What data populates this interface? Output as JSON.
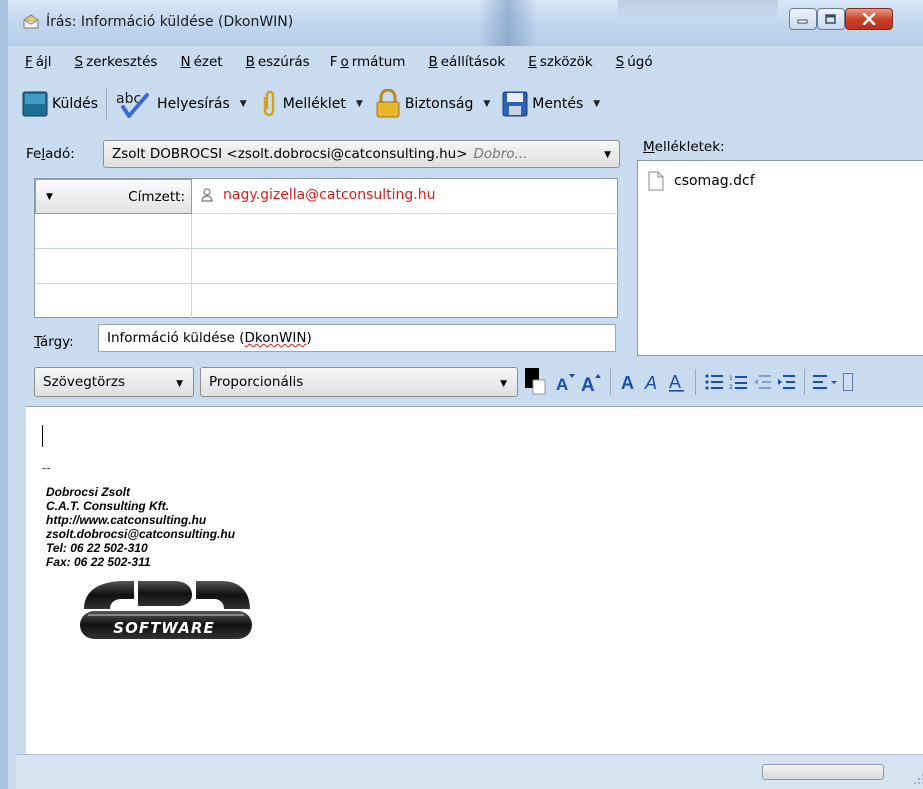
{
  "window": {
    "title": "Írás: Információ küldése (DkonWIN)"
  },
  "menu": [
    {
      "pre": "",
      "u": "F",
      "post": "ájl"
    },
    {
      "pre": "",
      "u": "S",
      "post": "zerkesztés"
    },
    {
      "pre": "",
      "u": "N",
      "post": "ézet"
    },
    {
      "pre": "",
      "u": "B",
      "post": "eszúrás"
    },
    {
      "pre": "F",
      "u": "o",
      "post": "rmátum"
    },
    {
      "pre": "",
      "u": "B",
      "post": "eállítások"
    },
    {
      "pre": "",
      "u": "E",
      "post": "szközök"
    },
    {
      "pre": "",
      "u": "S",
      "post": "úgó"
    }
  ],
  "toolbar": {
    "send": "Küldés",
    "spell": "Helyesírás",
    "spell_icon_text": "abc",
    "attach": "Melléklet",
    "security": "Biztonság",
    "save": "Mentés"
  },
  "from": {
    "label_pre": "Fe",
    "label_u": "l",
    "label_post": "adó:",
    "value": "Zsolt DOBROCSI <zsolt.dobrocsi@catconsulting.hu>",
    "alias": "Dobro..."
  },
  "recipients": {
    "type_label": "Címzett:",
    "address": "nagy.gizella@catconsulting.hu"
  },
  "subject": {
    "label_u": "T",
    "label_post": "árgy:",
    "value_pre": "Információ küldése (",
    "value_spell": "DkonWIN",
    "value_post": ")"
  },
  "attachments": {
    "label_u": "M",
    "label_post": "ellékletek:",
    "items": [
      "csomag.dcf"
    ]
  },
  "format": {
    "paragraph": "Szövegtörzs",
    "font": "Proporcionális"
  },
  "signature": {
    "dash": "--",
    "lines": [
      "Dobrocsi Zsolt",
      "C.A.T. Consulting Kft.",
      "http://www.catconsulting.hu",
      "zsolt.dobrocsi@catconsulting.hu",
      "Tel: 06 22 502-310",
      "Fax: 06 22 502-311"
    ],
    "logo_text": "ARD",
    "logo_subtext": "SOFTWARE"
  },
  "colors": {
    "accent": "#1a4fa8",
    "recipient": "#d61f1f",
    "window_frame": "#c9dbee"
  }
}
